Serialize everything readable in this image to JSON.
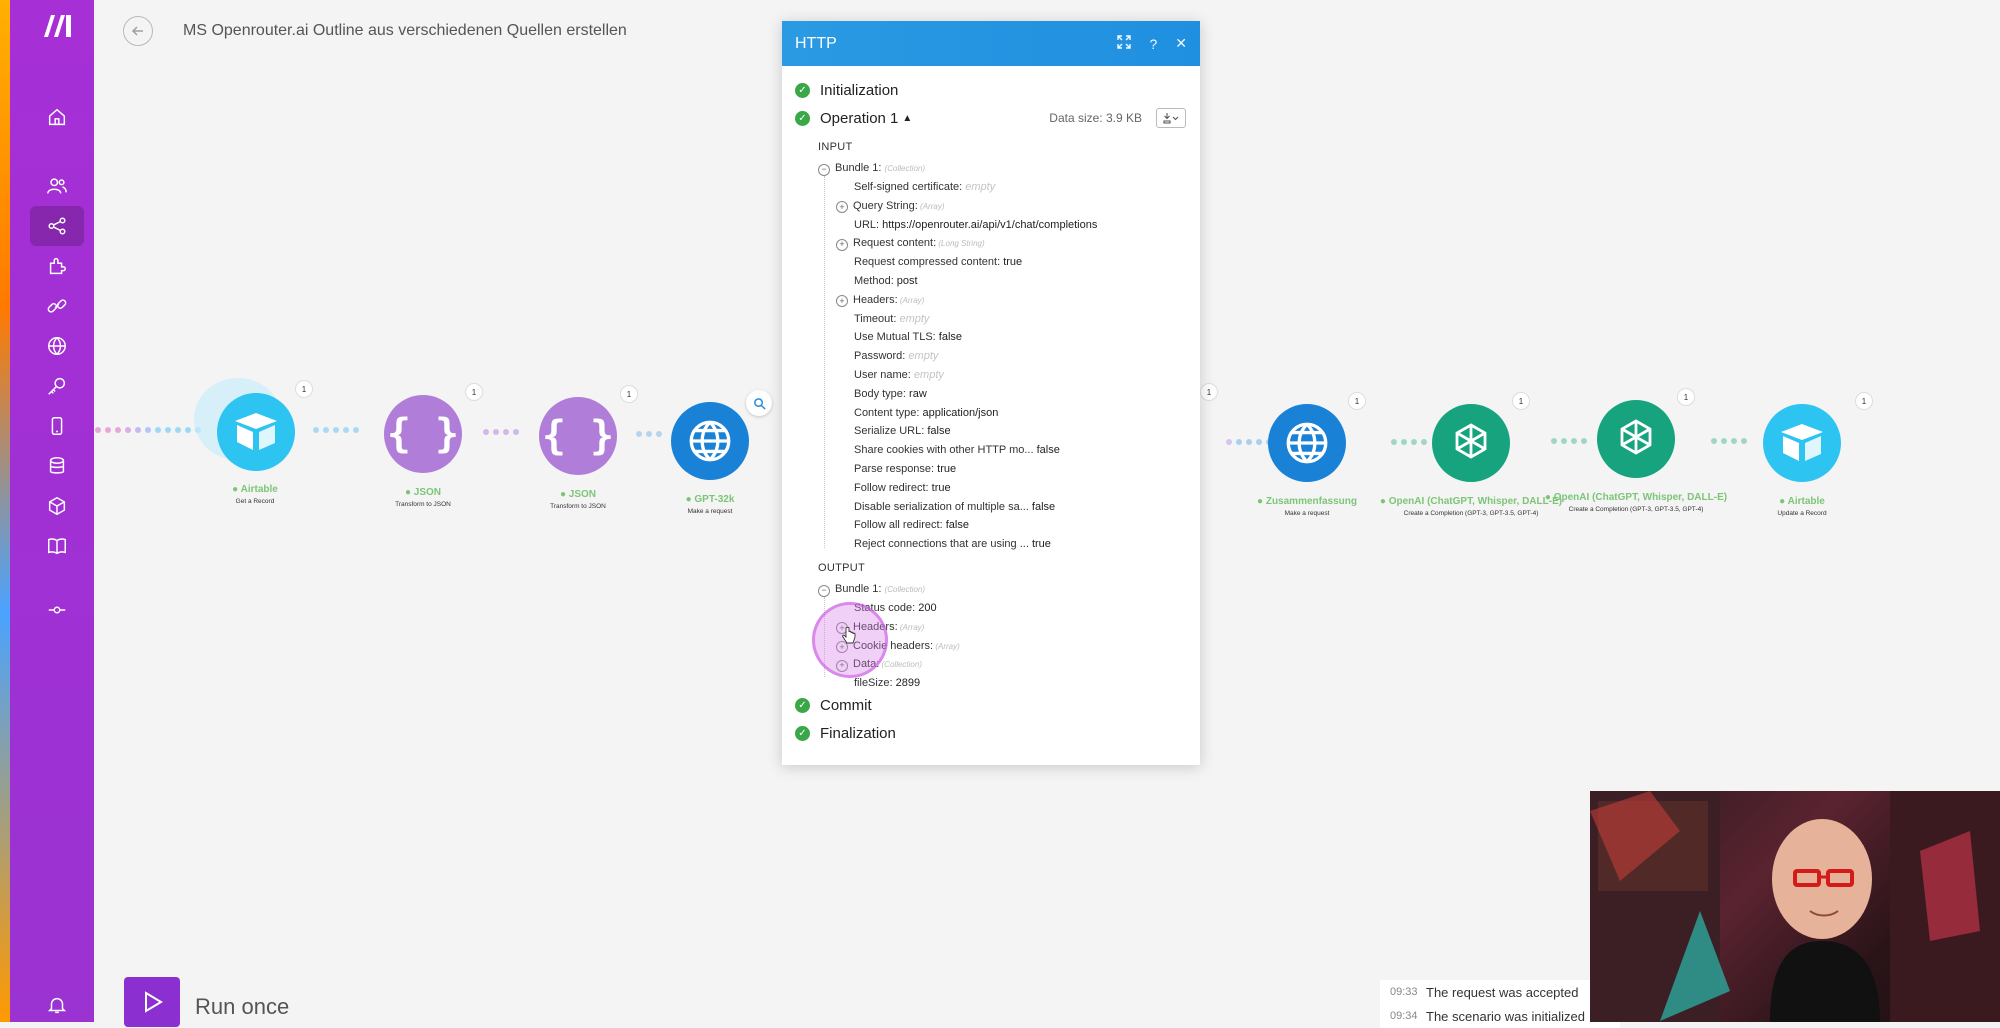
{
  "header": {
    "scenario_title": "MS Openrouter.ai Outline aus verschiedenen Quellen erstellen"
  },
  "sidebar": {
    "items": [
      "home-icon",
      "team-icon",
      "scenarios-icon",
      "apps-icon",
      "connections-icon",
      "webhooks-icon",
      "keys-icon",
      "devices-icon",
      "datastores-icon",
      "datastructures-icon",
      "docs-icon",
      "more-icon"
    ],
    "bottom": "notifications-icon"
  },
  "modules": [
    {
      "name": "Airtable",
      "sub": "Get a Record",
      "count": "1",
      "color": "#2ec4f1"
    },
    {
      "name": "JSON",
      "sub": "Transform to JSON",
      "count": "1",
      "color": "#b07ed9"
    },
    {
      "name": "JSON",
      "sub": "Transform to JSON",
      "count": "1",
      "color": "#b07ed9"
    },
    {
      "name": "GPT-32k",
      "sub": "Make a request",
      "count": "",
      "color": "#1a82d6"
    },
    {
      "name": "Zusammenfassung",
      "sub": "Make a request",
      "count": "1",
      "color": "#1a82d6"
    },
    {
      "name": "OpenAI (ChatGPT, Whisper, DALL-E)",
      "sub": "Create a Completion (GPT-3, GPT-3.5, GPT-4)",
      "count": "1",
      "color": "#16a37e"
    },
    {
      "name": "OpenAI (ChatGPT, Whisper, DALL-E)",
      "sub": "Create a Completion (GPT-3, GPT-3.5, GPT-4)",
      "count": "1",
      "color": "#16a37e"
    },
    {
      "name": "Airtable",
      "sub": "Update a Record",
      "count": "1",
      "color": "#2ec4f1"
    }
  ],
  "hidden_count": "1",
  "panel": {
    "title": "HTTP",
    "initialization": "Initialization",
    "operation": "Operation 1",
    "data_size": "Data size: 3.9 KB",
    "input_label": "INPUT",
    "output_label": "OUTPUT",
    "bundle_label": "Bundle 1:",
    "collection_tag": "(Collection)",
    "input_rows": [
      {
        "k": "Self-signed certificate:",
        "v": "",
        "e": "empty",
        "t": "",
        "toggle": ""
      },
      {
        "k": "Query String:",
        "v": "",
        "e": "",
        "t": "(Array)",
        "toggle": "+"
      },
      {
        "k": "URL:",
        "v": "https://openrouter.ai/api/v1/chat/completions",
        "e": "",
        "t": "",
        "toggle": ""
      },
      {
        "k": "Request content:",
        "v": "",
        "e": "",
        "t": "(Long String)",
        "toggle": "+"
      },
      {
        "k": "Request compressed content:",
        "v": "true",
        "e": "",
        "t": "",
        "toggle": ""
      },
      {
        "k": "Method:",
        "v": "post",
        "e": "",
        "t": "",
        "toggle": ""
      },
      {
        "k": "Headers:",
        "v": "",
        "e": "",
        "t": "(Array)",
        "toggle": "+"
      },
      {
        "k": "Timeout:",
        "v": "",
        "e": "empty",
        "t": "",
        "toggle": ""
      },
      {
        "k": "Use Mutual TLS:",
        "v": "false",
        "e": "",
        "t": "",
        "toggle": ""
      },
      {
        "k": "Password:",
        "v": "",
        "e": "empty",
        "t": "",
        "toggle": ""
      },
      {
        "k": "User name:",
        "v": "",
        "e": "empty",
        "t": "",
        "toggle": ""
      },
      {
        "k": "Body type:",
        "v": "raw",
        "e": "",
        "t": "",
        "toggle": ""
      },
      {
        "k": "Content type:",
        "v": "application/json",
        "e": "",
        "t": "",
        "toggle": ""
      },
      {
        "k": "Serialize URL:",
        "v": "false",
        "e": "",
        "t": "",
        "toggle": ""
      },
      {
        "k": "Share cookies with other HTTP mo...",
        "v": "false",
        "e": "",
        "t": "",
        "toggle": ""
      },
      {
        "k": "Parse response:",
        "v": "true",
        "e": "",
        "t": "",
        "toggle": ""
      },
      {
        "k": "Follow redirect:",
        "v": "true",
        "e": "",
        "t": "",
        "toggle": ""
      },
      {
        "k": "Disable serialization of multiple sa...",
        "v": "false",
        "e": "",
        "t": "",
        "toggle": ""
      },
      {
        "k": "Follow all redirect:",
        "v": "false",
        "e": "",
        "t": "",
        "toggle": ""
      },
      {
        "k": "Reject connections that are using ...",
        "v": "true",
        "e": "",
        "t": "",
        "toggle": ""
      }
    ],
    "output_rows": [
      {
        "k": "Status code:",
        "v": "200",
        "e": "",
        "t": "",
        "toggle": ""
      },
      {
        "k": "Headers:",
        "v": "",
        "e": "",
        "t": "(Array)",
        "toggle": "+"
      },
      {
        "k": "Cookie headers:",
        "v": "",
        "e": "",
        "t": "(Array)",
        "toggle": "+"
      },
      {
        "k": "Data:",
        "v": "",
        "e": "",
        "t": "(Collection)",
        "toggle": "+"
      },
      {
        "k": "fileSize:",
        "v": "2899",
        "e": "",
        "t": "",
        "toggle": ""
      }
    ],
    "commit": "Commit",
    "finalization": "Finalization"
  },
  "run": {
    "label": "Run once"
  },
  "log": [
    {
      "time": "09:33",
      "text": "The request was accepted"
    },
    {
      "time": "09:34",
      "text": "The scenario was initialized"
    }
  ]
}
